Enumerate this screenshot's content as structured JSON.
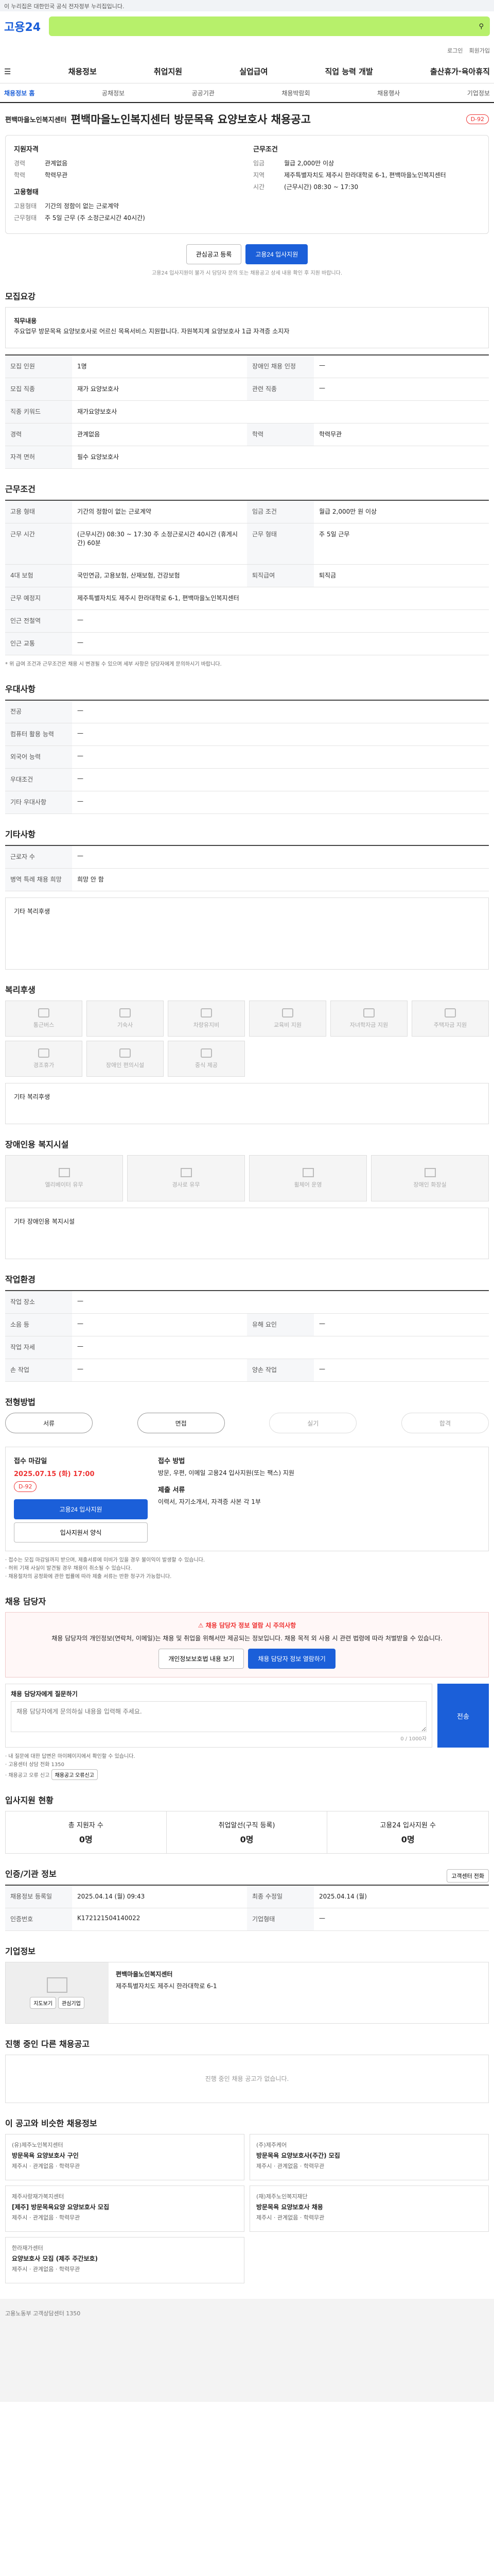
{
  "gov_notice": "이 누리집은 대한민국 공식 전자정부 누리집입니다.",
  "logo": "고용24",
  "search": {
    "placeholder": ""
  },
  "util": [
    "로그인",
    "회원가입"
  ],
  "gnb": [
    "채용정보",
    "취업지원",
    "실업급여",
    "직업 능력 개발",
    "출산휴가·육아휴직"
  ],
  "subnav": [
    "채용정보 홈",
    "공채정보",
    "공공기관",
    "채용박람회",
    "채용행사",
    "기업정보"
  ],
  "company_tag": "편백마을노인복지센터",
  "job_title": "편백마을노인복지센터 방문목욕 요양보호사 채용공고",
  "deadline_badge": "D-92",
  "summary": {
    "left_title": "지원자격",
    "left": [
      {
        "k": "경력",
        "v": "관계없음"
      },
      {
        "k": "학력",
        "v": "학력무관"
      }
    ],
    "left_title2": "고용형태",
    "left2": [
      {
        "k": "고용형태",
        "v": "기간의 정함이 없는 근로계약"
      },
      {
        "k": "근무형태",
        "v": "주 5일 근무 (주 소정근로시간 40시간)"
      }
    ],
    "right_title": "근무조건",
    "right": [
      {
        "k": "임금",
        "v": "월급 2,000만 이상"
      },
      {
        "k": "지역",
        "v": "제주특별자치도 제주시 한라대학로 6-1, 편백마을노인복지센터"
      },
      {
        "k": "시간",
        "v": "(근무시간) 08:30 ~ 17:30"
      }
    ],
    "btn_interest": "관심공고 등록",
    "btn_apply": "고용24 입사지원",
    "mini_notice": "고용24 입사지원이 불가 시 담당자 문의 또는 채용공고 상세 내용 확인 후 지원 바랍니다."
  },
  "sec_recruit": {
    "title": "모집요강",
    "duty_label": "직무내용",
    "duty": "주요업무 방문목욕 요양보호사로 어르신 목욕서비스 지원합니다. 자원복지계 요양보호사 1급 자격증 소지자",
    "rows": [
      {
        "th": "모집 인원",
        "td": "1명",
        "th2": "장애인 채용 인정",
        "td2": "—"
      },
      {
        "th": "모집 직종",
        "td": "재가 요양보호사",
        "th2": "관련 직종",
        "td2": "—"
      },
      {
        "th": "직종 키워드",
        "td": "재가요양보호사",
        "th2": "",
        "td2": ""
      },
      {
        "th": "경력",
        "td": "관계없음",
        "th2": "학력",
        "td2": "학력무관"
      },
      {
        "th": "자격 면허",
        "td": "필수  요양보호사",
        "th2": "",
        "td2": ""
      }
    ]
  },
  "sec_condition": {
    "title": "근무조건",
    "rows": [
      {
        "th": "고용 형태",
        "td": "기간의 정함이 없는 근로계약",
        "th2": "임금 조건",
        "td2": "월급 2,000만 원 이상"
      },
      {
        "th": "근무 시간",
        "td": "(근무시간) 08:30 ~ 17:30  주 소정근로시간 40시간  (휴게시간) 60분",
        "th2": "근무 형태",
        "td2": "주 5일 근무"
      },
      {
        "th": "4대 보험",
        "td": "국민연금, 고용보험, 산재보험, 건강보험",
        "th2": "퇴직급여",
        "td2": "퇴직금"
      },
      {
        "th": "근무 예정지",
        "td": "제주특별자치도 제주시 한라대학로 6-1, 편백마을노인복지센터",
        "th2": "",
        "td2": ""
      },
      {
        "th": "인근 전철역",
        "td": "—",
        "th2": "",
        "td2": ""
      },
      {
        "th": "인근 교통",
        "td": "—",
        "th2": "",
        "td2": ""
      }
    ],
    "note": "* 위 급여 조건과 근무조건은 채용 시 변경될 수 있으며 세부 사항은 담당자에게 문의하시기 바랍니다."
  },
  "sec_preference": {
    "title": "우대사항",
    "rows": [
      {
        "th": "전공",
        "td": "—"
      },
      {
        "th": "컴퓨터 활용 능력",
        "td": "—"
      },
      {
        "th": "외국어 능력",
        "td": "—"
      },
      {
        "th": "우대조건",
        "td": "—"
      },
      {
        "th": "기타 우대사항",
        "td": "—"
      }
    ]
  },
  "sec_etc": {
    "title": "기타사항",
    "rows": [
      {
        "th": "근로자 수",
        "td": "—"
      },
      {
        "th": "병역 특례 채용 희망",
        "td": "희망 안 함"
      }
    ],
    "box_label": "기타 복리후생"
  },
  "sec_welfare": {
    "title": "복리후생",
    "items": [
      "통근버스",
      "기숙사",
      "차량유지비",
      "교육비 지원",
      "자녀학자금 지원",
      "주택자금 지원",
      "경조휴가",
      "장애인 편의시설",
      "중식 제공"
    ],
    "extra": "기타 복리후생"
  },
  "sec_disability": {
    "title": "장애인용 복지시설",
    "items": [
      "엘리베이터 유무",
      "경사로 유무",
      "휠체어 운영",
      "장애인 화장실"
    ],
    "extra": "기타 장애인용 복지시설"
  },
  "sec_company": {
    "title": "작업환경",
    "rows": [
      {
        "th": "작업 장소",
        "td": "—",
        "th2": "",
        "td2": ""
      },
      {
        "th": "소음 등",
        "td": "—",
        "th2": "유해 요인",
        "td2": "—"
      },
      {
        "th": "작업 자세",
        "td": "—",
        "th2": "",
        "td2": ""
      },
      {
        "th": "손 작업",
        "td": "—",
        "th2": "양손 작업",
        "td2": "—"
      }
    ]
  },
  "sec_process": {
    "title": "전형방법",
    "steps": [
      "서류",
      "면접",
      "실기",
      "합격"
    ]
  },
  "sec_apply": {
    "period_label": "접수 마감일",
    "period": "2025.07.15 (화) 17:00",
    "d_day": "D-92",
    "method_label": "접수 방법",
    "method": "방문, 우편, 이메일 고용24 입사지원(또는 팩스) 지원",
    "docs_label": "제출 서류",
    "docs": "이력서, 자기소개서, 자격증 사본 각 1부",
    "btn_apply": "고용24 입사지원",
    "btn_form": "입사지원서 양식",
    "notes": [
      "· 접수는 모집 마감일까지 받으며, 제출서류에 미비가 있을 경우 불이익이 발생할 수 있습니다.",
      "· 허위 기재 사실이 발견될 경우 채용이 취소될 수 있습니다.",
      "· 채용절차의 공정화에 관한 법률에 따라 제출 서류는 반환 청구가 가능합니다."
    ]
  },
  "sec_manager": {
    "title": "채용 담당자",
    "warn_title": "채용 담당자 정보 열람 시 주의사항",
    "warn_body": "채용 담당자의 개인정보(연락처, 이메일)는 채용 및 취업을 위해서만 제공되는 정보입니다. 채용 목적 외 사용 시 관련 법령에 따라 처벌받을 수 있습니다.",
    "btn1": "개인정보보호법 내용 보기",
    "btn2": "채용 담당자 정보 열람하기",
    "inquiry_label": "채용 담당자에게 질문하기",
    "inquiry_placeholder": "채용 담당자에게 문의하실 내용을 입력해 주세요.",
    "inquiry_count": "0 / 1000자",
    "send": "전송",
    "inquiry_notes": [
      "· 내 질문에 대한 답변은 마이페이지에서 확인할 수 있습니다.",
      "· 고용센터 상담 전화 1350",
      "· 채용공고 오류 신고"
    ],
    "report_btn": "채용공고 오류신고"
  },
  "sec_stats": {
    "title": "입사지원 현황",
    "items": [
      {
        "label": "총 지원자 수",
        "value": "0명"
      },
      {
        "label": "취업알선(구직 등록)",
        "value": "0명"
      },
      {
        "label": "고용24 입사지원 수",
        "value": "0명"
      }
    ]
  },
  "sec_info": {
    "title": "인증/기관 정보",
    "rows": [
      {
        "th": "채용정보 등록일",
        "td": "2025.04.14 (월) 09:43",
        "th2": "최종 수정일",
        "td2": "2025.04.14 (월)"
      },
      {
        "th": "인증번호",
        "td": "K172121504140022",
        "th2": "기업형태",
        "td2": "—"
      }
    ],
    "btn": "고객센터 전화"
  },
  "sec_map": {
    "title": "기업정보",
    "company": "편백마을노인복지센터",
    "addr": "제주특별자치도 제주시 한라대학로 6-1",
    "btn1": "지도보기",
    "btn2": "관심기업"
  },
  "sec_similar": {
    "title": "진행 중인 다른 채용공고",
    "empty": "진행 중인 채용 공고가 없습니다."
  },
  "sec_recommend": {
    "title": "이 공고와 비슷한 채용정보",
    "cards": [
      {
        "co": "(유)제주노인복지센터",
        "title": "방문목욕 요양보호사 구인",
        "meta": "제주시 · 관계없음 · 학력무관"
      },
      {
        "co": "(주)제주케어",
        "title": "방문목욕 요양보호사(주간) 모집",
        "meta": "제주시 · 관계없음 · 학력무관"
      },
      {
        "co": "제주사랑재가복지센터",
        "title": "[제주] 방문목욕요양 요양보호사 모집",
        "meta": "제주시 · 관계없음 · 학력무관"
      },
      {
        "co": "(재)제주노인복지재단",
        "title": "방문목욕 요양보호사 채용",
        "meta": "제주시 · 관계없음 · 학력무관"
      },
      {
        "co": "한라재가센터",
        "title": "요양보호사 모집 (제주 주간보호)",
        "meta": "제주시 · 관계없음 · 학력무관"
      }
    ]
  },
  "footer": "고용노동부 고객상담센터 1350"
}
